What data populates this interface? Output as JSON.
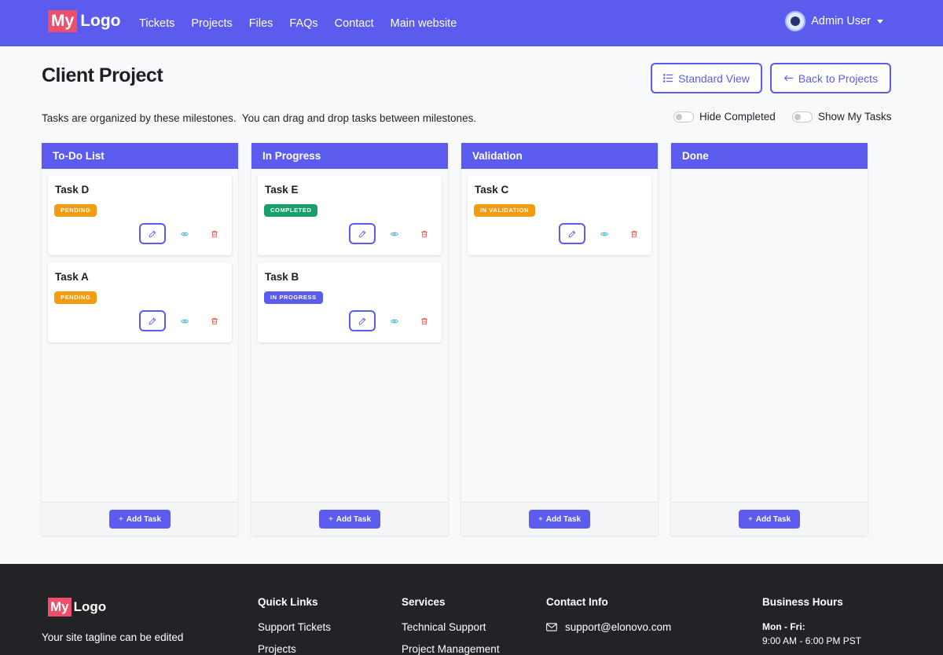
{
  "nav": {
    "logo_my": "My",
    "logo_text": "Logo",
    "links": [
      "Tickets",
      "Projects",
      "Files",
      "FAQs",
      "Contact",
      "Main website"
    ],
    "user_name": "Admin User"
  },
  "header": {
    "title": "Client Project",
    "standard_view_label": "Standard View",
    "back_label": "Back to Projects",
    "instructions": "Tasks are organized by these milestones.  You can drag and drop tasks between milestones.",
    "hide_completed_label": "Hide Completed",
    "show_my_tasks_label": "Show My Tasks",
    "hide_completed_on": false,
    "show_my_tasks_on": false
  },
  "columns": [
    {
      "title": "To-Do List",
      "add_label": "Add Task",
      "tasks": [
        {
          "title": "Task D",
          "status": "PENDING",
          "status_color": "#f39c12"
        },
        {
          "title": "Task A",
          "status": "PENDING",
          "status_color": "#f39c12"
        }
      ]
    },
    {
      "title": "In Progress",
      "add_label": "Add Task",
      "tasks": [
        {
          "title": "Task E",
          "status": "COMPLETED",
          "status_color": "#17a06a"
        },
        {
          "title": "Task B",
          "status": "IN PROGRESS",
          "status_color": "#5b5ced"
        }
      ]
    },
    {
      "title": "Validation",
      "add_label": "Add Task",
      "tasks": [
        {
          "title": "Task C",
          "status": "IN VALIDATION",
          "status_color": "#f39c12"
        }
      ]
    },
    {
      "title": "Done",
      "add_label": "Add Task",
      "tasks": []
    }
  ],
  "footer": {
    "logo_my": "My",
    "logo_text": "Logo",
    "tagline": "Your site tagline can be edited",
    "quick_links_heading": "Quick Links",
    "quick_links": [
      "Support Tickets",
      "Projects"
    ],
    "services_heading": "Services",
    "services": [
      "Technical Support",
      "Project Management"
    ],
    "contact_heading": "Contact Info",
    "email": "support@elonovo.com",
    "hours_heading": "Business Hours",
    "hours_label": "Mon - Fri:",
    "hours_value": "9:00 AM - 6:00 PM PST"
  },
  "colors": {
    "primary": "#5b5ced",
    "logo_accent": "#ef4f6b",
    "view_icon": "#3fb7d9",
    "delete_icon": "#e5534b",
    "footer_bg": "#212326"
  },
  "icons": {
    "standard_view": "list-icon",
    "back": "arrow-left-icon",
    "edit": "pencil-icon",
    "view": "eye-icon",
    "delete": "trash-icon",
    "add": "plus-icon",
    "email": "envelope-icon"
  }
}
